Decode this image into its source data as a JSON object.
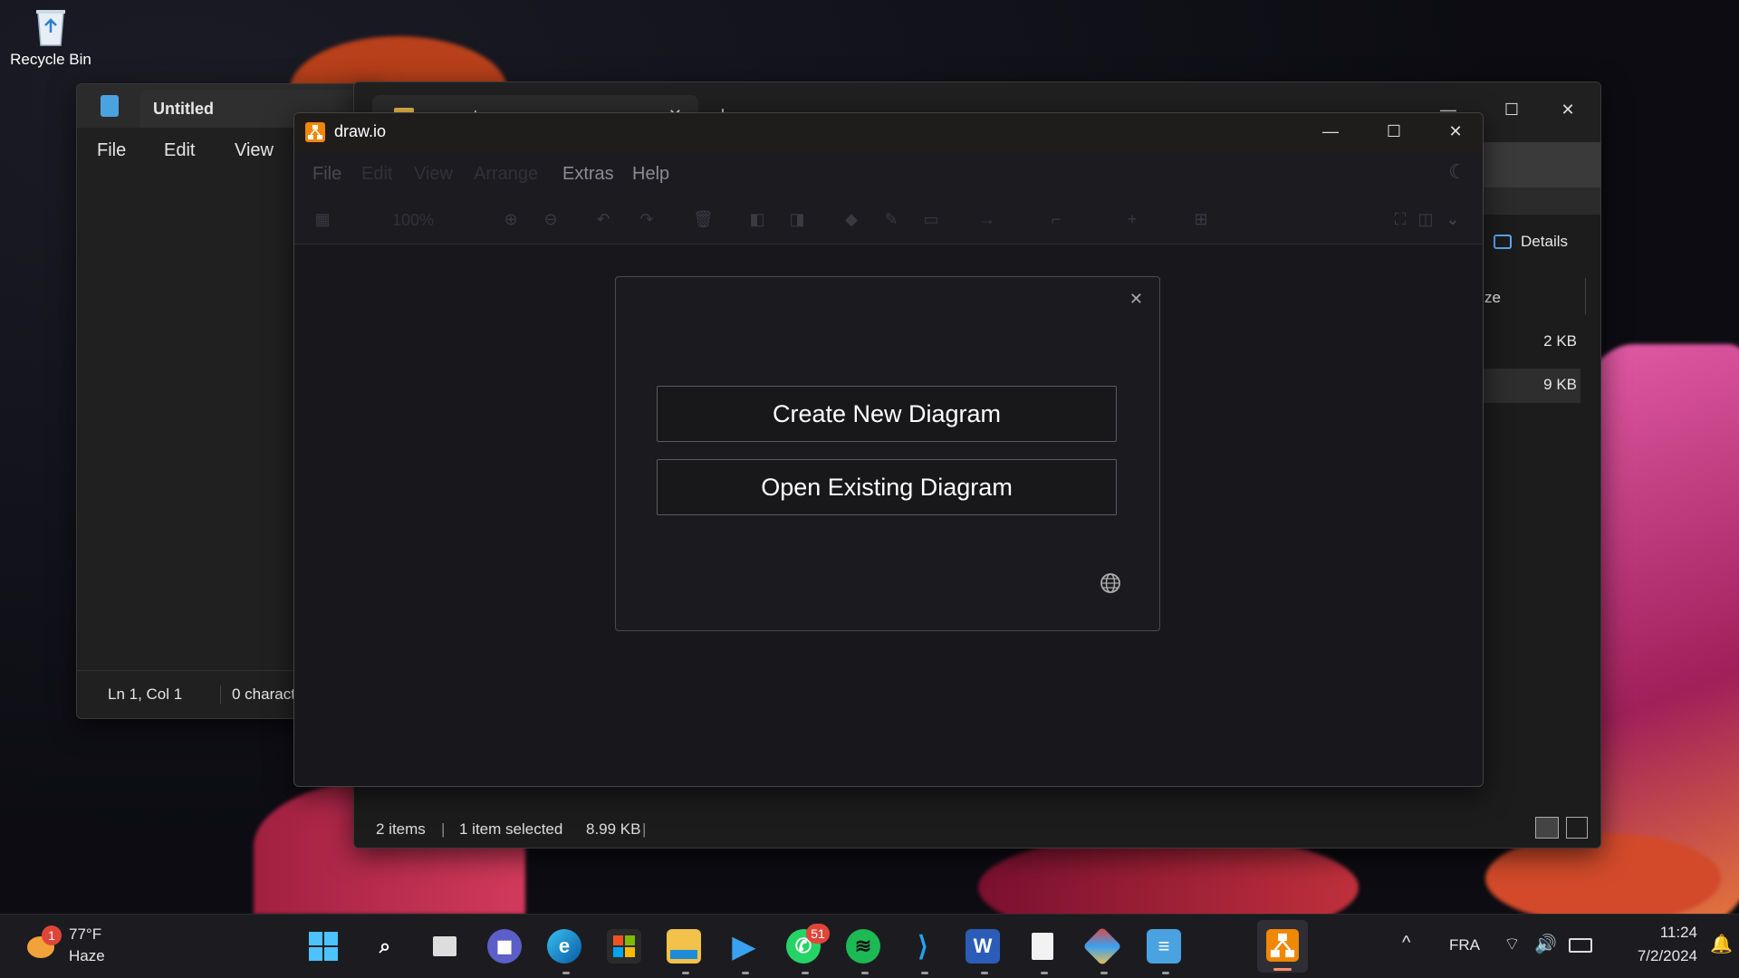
{
  "desktop": {
    "recycle_bin_label": "Recycle Bin"
  },
  "notepad": {
    "tab_title": "Untitled",
    "menu": [
      "File",
      "Edit",
      "View"
    ],
    "status_position": "Ln 1, Col 1",
    "status_chars": "0 charact"
  },
  "explorer": {
    "tab_partial": "manual",
    "details_label": "Details",
    "size_header": "ize",
    "sizes": [
      "2 KB",
      "9 KB"
    ],
    "status_items": "2 items",
    "status_selected": "1 item selected",
    "status_size": "8.99 KB"
  },
  "drawio": {
    "title": "draw.io",
    "menu": [
      "File",
      "Edit",
      "View",
      "Arrange",
      "Extras",
      "Help"
    ],
    "zoom": "100%",
    "dialog": {
      "create_label": "Create New Diagram",
      "open_label": "Open Existing Diagram"
    }
  },
  "taskbar": {
    "weather_temp": "77°F",
    "weather_desc": "Haze",
    "weather_badge": "1",
    "whatsapp_badge": "51",
    "language": "FRA",
    "time": "11:24",
    "date": "7/2/2024"
  },
  "colors": {
    "drawio_orange": "#f08705",
    "accent_blue": "#0078d4"
  }
}
